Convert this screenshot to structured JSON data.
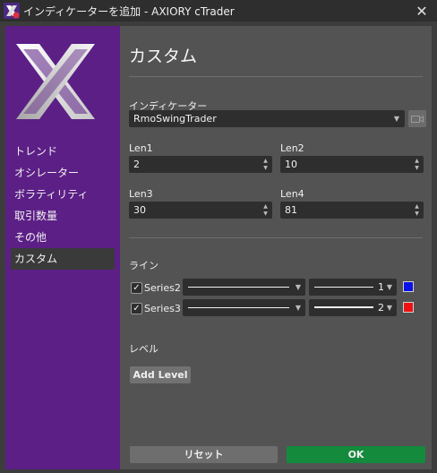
{
  "window": {
    "title": "インディケーターを追加 - AXIORY cTrader",
    "close_glyph": "✕"
  },
  "sidebar": {
    "items": [
      {
        "label": "トレンド"
      },
      {
        "label": "オシレーター"
      },
      {
        "label": "ボラティリティ"
      },
      {
        "label": "取引数量"
      },
      {
        "label": "その他"
      },
      {
        "label": "カスタム"
      }
    ],
    "active": "カスタム",
    "bg_color": "#5c1f86"
  },
  "main": {
    "title": "カスタム",
    "indicator_label": "インディケーター",
    "indicator_value": "RmoSwingTrader",
    "params": [
      {
        "label": "Len1",
        "value": "2"
      },
      {
        "label": "Len2",
        "value": "10"
      },
      {
        "label": "Len3",
        "value": "30"
      },
      {
        "label": "Len4",
        "value": "81"
      }
    ],
    "lines_section": "ライン",
    "lines": [
      {
        "checked": true,
        "name": "Series2",
        "thickness": "1",
        "color": "#0b10e6"
      },
      {
        "checked": true,
        "name": "Series3",
        "thickness": "2",
        "color": "#ef1111"
      }
    ],
    "levels_section": "レベル",
    "add_level_label": "Add Level",
    "reset_label": "リセット",
    "ok_label": "OK",
    "ok_color": "#138a3c"
  }
}
